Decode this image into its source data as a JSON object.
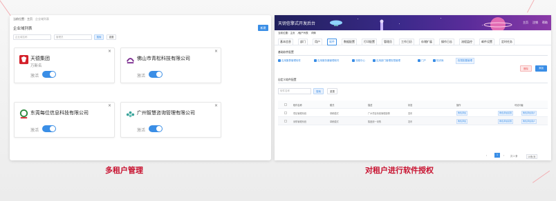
{
  "left": {
    "breadcrumb": [
      "当前位置：主页",
      "企业域列表"
    ],
    "title": "企业域列表",
    "new_button": "新建",
    "search_placeholders": [
      "企业域名称",
      "管理员"
    ],
    "search_button": "搜索",
    "reset_button": "重置",
    "tenants": [
      {
        "name": "天德集团",
        "sub": "万新名",
        "status": "激活",
        "logo_color": "#d4202a"
      },
      {
        "name": "佛山市青松科技有限公司",
        "sub": "",
        "status": "激活",
        "logo_color": "#7b2c8e"
      },
      {
        "name": "东莞每位信息科技有限公司",
        "sub": "",
        "status": "激活",
        "logo_color": "#2d8a3e"
      },
      {
        "name": "广州智慧咨询管理有限公司",
        "sub": "",
        "status": "激活",
        "logo_color": "#3aa39a"
      }
    ],
    "close_icon": "×"
  },
  "right": {
    "app_title": "天钥信擎式开发后台",
    "header_links": [
      "主页",
      "注销",
      "帮助"
    ],
    "breadcrumb": [
      "当前位置：主页",
      "/租户列表",
      "详情"
    ],
    "tabs": [
      "基本信息",
      "部门",
      "用户",
      "软件",
      "数据配置",
      "打印配置",
      "管理员",
      "工作日历",
      "存储扩展",
      "操作日志",
      "流程监控",
      "邮件设置",
      "定时任务"
    ],
    "active_tab": 3,
    "section1": "基础软件配置",
    "checkboxes": [
      "应用集群管理软件",
      "应用服务器管理软件",
      "流程中心",
      "应用部门管理权限管理",
      "门户",
      "知识库",
      "权限配置管理"
    ],
    "delete_button": "删除",
    "add_button": "添加",
    "section2": "自定义软件配置",
    "search_placeholder": "软件名称",
    "search_button": "搜索",
    "reset_button": "重置",
    "table_headers": [
      "软件名称",
      "模式",
      "描述",
      "状态",
      "操作",
      "可访问者"
    ],
    "rows": [
      {
        "name": "项目管理系统",
        "mode": "草稿模式",
        "desc": "广州项目系统管理部署",
        "status": "发布",
        "ops": "角色添加",
        "access1": "角色添加权限",
        "access2": "角色添加用户"
      },
      {
        "name": "采购管理系统",
        "mode": "草稿模式",
        "desc": "集团统一采购",
        "status": "发布",
        "ops": "角色添加",
        "access1": "角色添加权限",
        "access2": "角色添加用户"
      }
    ],
    "pagination": {
      "current": "1",
      "total": "共 2 条",
      "per_page": "10条/页"
    }
  },
  "captions": {
    "left": "多租户管理",
    "right": "对租户进行软件授权"
  },
  "colors": {
    "accent": "#3a8ee6",
    "caption": "#c8102e",
    "header_start": "#20205c",
    "header_end": "#8b3aa8"
  }
}
